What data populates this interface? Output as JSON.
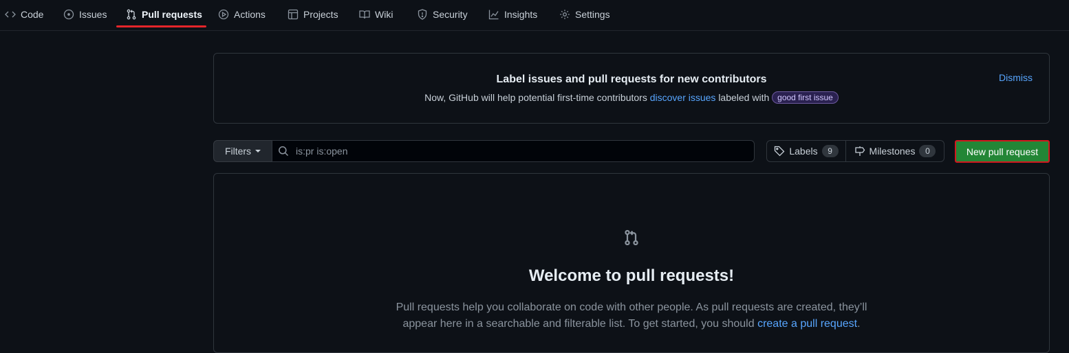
{
  "nav": {
    "tabs": [
      {
        "label": "Code",
        "icon": "code-icon"
      },
      {
        "label": "Issues",
        "icon": "issue-icon"
      },
      {
        "label": "Pull requests",
        "icon": "pull-request-icon",
        "active": true
      },
      {
        "label": "Actions",
        "icon": "play-icon"
      },
      {
        "label": "Projects",
        "icon": "table-icon"
      },
      {
        "label": "Wiki",
        "icon": "book-icon"
      },
      {
        "label": "Security",
        "icon": "shield-icon"
      },
      {
        "label": "Insights",
        "icon": "graph-icon"
      },
      {
        "label": "Settings",
        "icon": "gear-icon"
      }
    ]
  },
  "banner": {
    "title": "Label issues and pull requests for new contributors",
    "text_before": "Now, GitHub will help potential first-time contributors",
    "link": "discover issues",
    "text_after": "labeled with",
    "label_pill": "good first issue",
    "dismiss": "Dismiss"
  },
  "toolbar": {
    "filters_label": "Filters",
    "search_value": "is:pr is:open",
    "labels_label": "Labels",
    "labels_count": "9",
    "milestones_label": "Milestones",
    "milestones_count": "0",
    "new_pr_label": "New pull request"
  },
  "blankslate": {
    "title": "Welcome to pull requests!",
    "text_line1": "Pull requests help you collaborate on code with other people. As pull requests are created, they’ll",
    "text_line2_before": "appear here in a searchable and filterable list. To get started, you should",
    "text_link": "create a pull request",
    "text_end": "."
  },
  "colors": {
    "background": "#0d1117",
    "accent_link": "#58a6ff",
    "primary_button": "#238636",
    "highlight": "#e5252a"
  }
}
